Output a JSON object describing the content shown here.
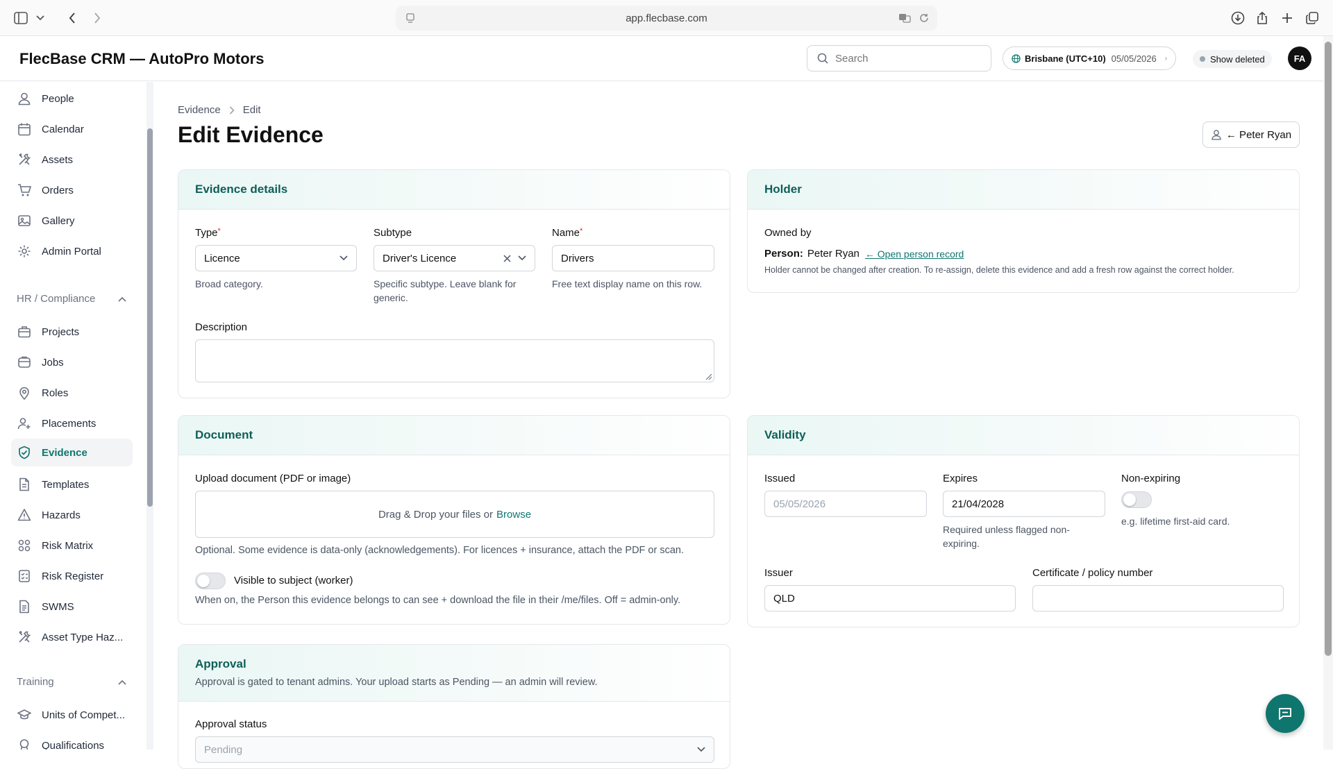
{
  "browser": {
    "url": "app.flecbase.com"
  },
  "header": {
    "app_title": "FlecBase CRM — AutoPro Motors",
    "search_placeholder": "Search",
    "timezone": "Brisbane (UTC+10)",
    "date": "05/05/2026",
    "show_deleted": "Show deleted",
    "avatar_initials": "FA"
  },
  "sidebar": {
    "items": [
      {
        "label": "People",
        "icon": "person-icon"
      },
      {
        "label": "Calendar",
        "icon": "calendar-icon"
      },
      {
        "label": "Assets",
        "icon": "tools-icon"
      },
      {
        "label": "Orders",
        "icon": "cart-icon"
      },
      {
        "label": "Gallery",
        "icon": "image-icon"
      },
      {
        "label": "Admin Portal",
        "icon": "gear-icon"
      }
    ],
    "group_hr": "HR / Compliance",
    "hr_items": [
      {
        "label": "Projects",
        "icon": "briefcase-icon"
      },
      {
        "label": "Jobs",
        "icon": "clipboard-icon"
      },
      {
        "label": "Roles",
        "icon": "pin-icon"
      },
      {
        "label": "Placements",
        "icon": "user-plus-icon"
      },
      {
        "label": "Evidence",
        "icon": "shield-check-icon"
      },
      {
        "label": "Templates",
        "icon": "document-icon"
      },
      {
        "label": "Hazards",
        "icon": "warning-icon"
      },
      {
        "label": "Risk Matrix",
        "icon": "grid-icon"
      },
      {
        "label": "Risk Register",
        "icon": "register-icon"
      },
      {
        "label": "SWMS",
        "icon": "file-text-icon"
      },
      {
        "label": "Asset Type Haz...",
        "icon": "tools-icon"
      }
    ],
    "group_training": "Training",
    "training_items": [
      {
        "label": "Units of Compet...",
        "icon": "graduation-icon"
      },
      {
        "label": "Qualifications",
        "icon": "award-icon"
      }
    ]
  },
  "page": {
    "breadcrumb": [
      "Evidence",
      "Edit"
    ],
    "title": "Edit Evidence",
    "person_button": "← Peter Ryan"
  },
  "evidence_details": {
    "heading": "Evidence details",
    "type_label": "Type",
    "type_value": "Licence",
    "type_help": "Broad category.",
    "subtype_label": "Subtype",
    "subtype_value": "Driver's Licence",
    "subtype_help": "Specific subtype. Leave blank for generic.",
    "name_label": "Name",
    "name_value": "Drivers",
    "name_help": "Free text display name on this row.",
    "description_label": "Description",
    "description_value": ""
  },
  "holder": {
    "heading": "Holder",
    "owned_by": "Owned by",
    "person_prefix": "Person:",
    "person_name": "Peter Ryan",
    "open_link": "← Open person record",
    "note": "Holder cannot be changed after creation. To re-assign, delete this evidence and add a fresh row against the correct holder."
  },
  "document": {
    "heading": "Document",
    "upload_label": "Upload document (PDF or image)",
    "dropzone_text": "Drag & Drop your files or",
    "browse": "Browse",
    "help": "Optional. Some evidence is data-only (acknowledgements). For licences + insurance, attach the PDF or scan.",
    "visible_label": "Visible to subject (worker)",
    "visible_help": "When on, the Person this evidence belongs to can see + download the file in their /me/files. Off = admin-only."
  },
  "validity": {
    "heading": "Validity",
    "issued_label": "Issued",
    "issued_placeholder": "05/05/2026",
    "expires_label": "Expires",
    "expires_value": "21/04/2028",
    "expires_help": "Required unless flagged non-expiring.",
    "nonexp_label": "Non-expiring",
    "nonexp_help": "e.g. lifetime first-aid card.",
    "issuer_label": "Issuer",
    "issuer_value": "QLD",
    "cert_label": "Certificate / policy number",
    "cert_value": ""
  },
  "approval": {
    "heading": "Approval",
    "subtext": "Approval is gated to tenant admins. Your upload starts as Pending — an admin will review.",
    "status_label": "Approval status",
    "status_value": "Pending"
  }
}
